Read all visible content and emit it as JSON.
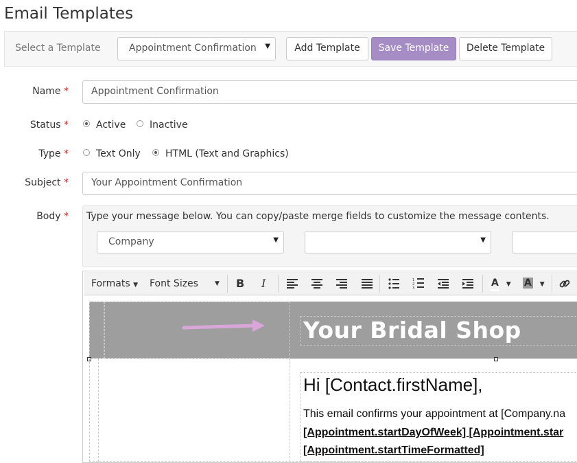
{
  "page": {
    "title": "Email Templates"
  },
  "template_bar": {
    "label": "Select a Template",
    "selected_template": "Appointment Confirmation",
    "add_label": "Add Template",
    "save_label": "Save Template",
    "delete_label": "Delete Template"
  },
  "form": {
    "name": {
      "label": "Name",
      "required": "*",
      "value": "Appointment Confirmation"
    },
    "status": {
      "label": "Status",
      "required": "*",
      "options": [
        "Active",
        "Inactive"
      ],
      "selected": "Active"
    },
    "type": {
      "label": "Type",
      "required": "*",
      "options": [
        "Text Only",
        "HTML (Text and Graphics)"
      ],
      "selected": "HTML (Text and Graphics)"
    },
    "subject": {
      "label": "Subject",
      "required": "*",
      "value": "Your Appointment Confirmation"
    },
    "body": {
      "label": "Body",
      "required": "*",
      "instructions": "Type your message below. You can copy/paste merge fields to customize the message contents.",
      "merge_group_selected": "Company",
      "merge_field_selected": "",
      "merge_third_selected": ""
    }
  },
  "editor": {
    "formats_label": "Formats",
    "font_sizes_label": "Font Sizes",
    "icons": [
      "bold-icon",
      "italic-icon",
      "align-left-icon",
      "align-center-icon",
      "align-right-icon",
      "align-justify-icon",
      "bullet-list-icon",
      "numbered-list-icon",
      "outdent-icon",
      "indent-icon",
      "text-color-icon",
      "background-color-icon",
      "link-icon"
    ],
    "bold_glyph": "B",
    "italic_glyph": "I",
    "text_color_glyph": "A",
    "bg_color_glyph": "A",
    "content": {
      "shop_name": "Your Bridal Shop",
      "greeting": "Hi [Contact.firstName],",
      "line1": "This email confirms your appointment at [Company.na",
      "line2": "[Appointment.startDayOfWeek] [Appointment.star",
      "line3": "[Appointment.startTimeFormatted]"
    },
    "banner_color": "#9e9e9e",
    "arrow_color": "#d9a6d9"
  },
  "colors": {
    "primary_button": "#a58cc4",
    "required_marker": "#c9302c"
  }
}
